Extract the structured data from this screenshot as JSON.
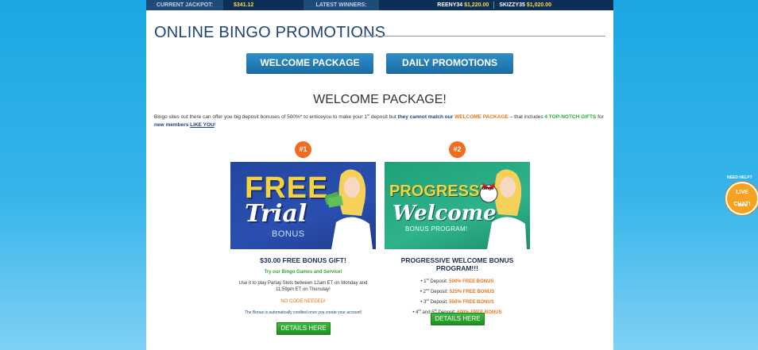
{
  "ticker": {
    "jackpot_label": "CURRENT JACKPOT:",
    "jackpot_value": "$341.12",
    "winners_label": "LATEST WINNERS:",
    "winners": [
      {
        "name": "REENY34",
        "amount": "$1,220.00"
      },
      {
        "name": "SKIZZY35",
        "amount": "$1,020.00"
      }
    ]
  },
  "page_title": "ONLINE BINGO PROMOTIONS",
  "tabs": [
    {
      "label": "WELCOME PACKAGE"
    },
    {
      "label": "DAILY PROMOTIONS"
    }
  ],
  "section_heading": "WELCOME PACKAGE!",
  "intro": {
    "p1": "Bingo sites out there can offer you big deposit bonuses of 500%* to enticeyou to make your 1",
    "p1_sup": "st",
    "p2": " deposit but ",
    "p3": "they cannot match our ",
    "p4": "WELCOME PACKAGE",
    "p5": " – that includes ",
    "p6": "4 TOP-NOTCH GIFTS",
    "p7": " for ",
    "p8": "new members ",
    "p9": "LIKE YOU",
    "p10": "!"
  },
  "promos": [
    {
      "badge": "#1",
      "banner_line1": "FREE",
      "banner_line2": "Trial",
      "banner_sub": "BONUS",
      "title": "$30.00 FREE BONUS GIFT!",
      "tagline": "Try our Bingo Games and Service!",
      "body": "Use it to play Parlay Slots between 12am ET on Monday and 11:59pm ET on Thursday!",
      "code_note": "NO CODE NEEDED!",
      "fine_print": "The Bonus is automatically credited once you create your account!",
      "button": "DETAILS HERE"
    },
    {
      "badge": "#2",
      "banner_line1": "PROGRESSIVE",
      "banner_line2": "Welcome",
      "banner_sub": "BONUS PROGRAM!",
      "banner_ball": "Bingo",
      "title": "PROGRESSIVE WELCOME BONUS PROGRAM!!!",
      "deposits": [
        {
          "ordinal": "1",
          "sup": "st",
          "label": " Deposit: ",
          "bonus": "500% FREE BONUS"
        },
        {
          "ordinal": "2",
          "sup": "nd",
          "label": " Deposit: ",
          "bonus": "525% FREE BONUS"
        },
        {
          "ordinal": "3",
          "sup": "rd",
          "label": " Deposit: ",
          "bonus": "550% FREE BONUS"
        },
        {
          "ordinal": "4",
          "sup": "th",
          "mid": " and 5",
          "sup2": "th",
          "label": " Deposit: ",
          "bonus": "600% FREE BONUS"
        }
      ],
      "button": "DETAILS HERE"
    }
  ],
  "help": {
    "need_help": "NEED HELP?",
    "live": "LIVE",
    "chat": "CHAT!"
  },
  "colors": {
    "navy": "#0d2f55",
    "accent_blue": "#1c4478",
    "orange": "#e8741c",
    "green": "#2fa53a",
    "gold": "#ffd84a"
  }
}
